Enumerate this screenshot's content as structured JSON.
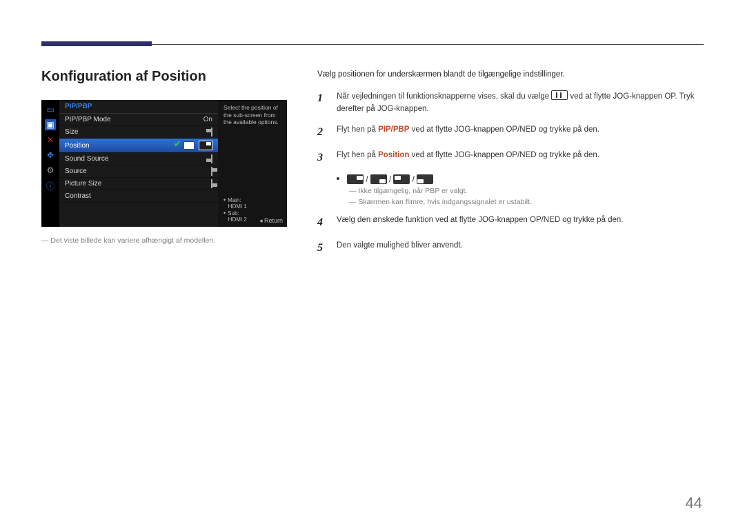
{
  "page_number": "44",
  "section_title": "Konfiguration af Position",
  "osd": {
    "header": "PIP/PBP",
    "rows": {
      "mode_label": "PIP/PBP Mode",
      "mode_value": "On",
      "size": "Size",
      "position": "Position",
      "sound": "Sound Source",
      "source": "Source",
      "picture_size": "Picture Size",
      "contrast": "Contrast"
    },
    "help": "Select the position of the sub-screen from the available options.",
    "main_label": "Main:",
    "main_value": "HDMI 1",
    "sub_label": "Sub:",
    "sub_value": "HDMI 2",
    "return": "Return"
  },
  "footnote_left": "Det viste billede kan variere afhængigt af modellen.",
  "intro": "Vælg positionen for underskærmen blandt de tilgængelige indstillinger.",
  "steps": {
    "s1a": "Når vejledningen til funktionsknapperne vises, skal du vælge ",
    "s1b": " ved at flytte JOG-knappen OP. Tryk derefter på JOG-knappen.",
    "s2a": "Flyt hen på ",
    "s2kw": "PIP/PBP",
    "s2b": " ved at flytte JOG-knappen OP/NED og trykke på den.",
    "s3a": "Flyt hen på ",
    "s3kw": "Position",
    "s3b": " ved at flytte JOG-knappen OP/NED og trykke på den.",
    "note1": "Ikke tilgængelig, når PBP er valgt.",
    "note2": "Skærmen kan flimre, hvis indgangssignalet er ustabilt.",
    "s4": "Vælg den ønskede funktion ved at flytte JOG-knappen OP/NED og trykke på den.",
    "s5": "Den valgte mulighed bliver anvendt."
  },
  "icon_sep": " / "
}
